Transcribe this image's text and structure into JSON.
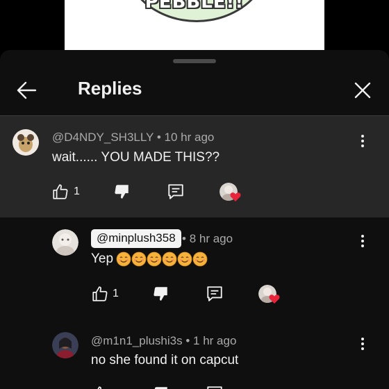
{
  "video": {
    "overlay_text": "PEBBLE!!"
  },
  "header": {
    "title": "Replies"
  },
  "parent_comment": {
    "author": "@D4NDY_SH3LLY",
    "time": "10 hr ago",
    "text": "wait...... YOU MADE THIS??",
    "likes": "1"
  },
  "replies": [
    {
      "author": "@minplush358",
      "time": "8 hr ago",
      "text": "Yep",
      "emoji": [
        "smiling-face-emoji",
        "smiling-face-emoji",
        "smiling-face-emoji",
        "smiling-face-emoji",
        "smiling-face-emoji",
        "smiling-face-emoji"
      ],
      "likes": "1"
    },
    {
      "author": "@m1n1_plushi3s",
      "time": "1 hr ago",
      "text": "no she found it on capcut"
    }
  ],
  "separator": "•",
  "colors": {
    "background": "#0f0f0f",
    "highlight_row": "#272727",
    "text_primary": "#f1f1f1",
    "text_secondary": "#aaaaaa",
    "heart": "#e8233c",
    "emoji": "#f7b23b"
  }
}
